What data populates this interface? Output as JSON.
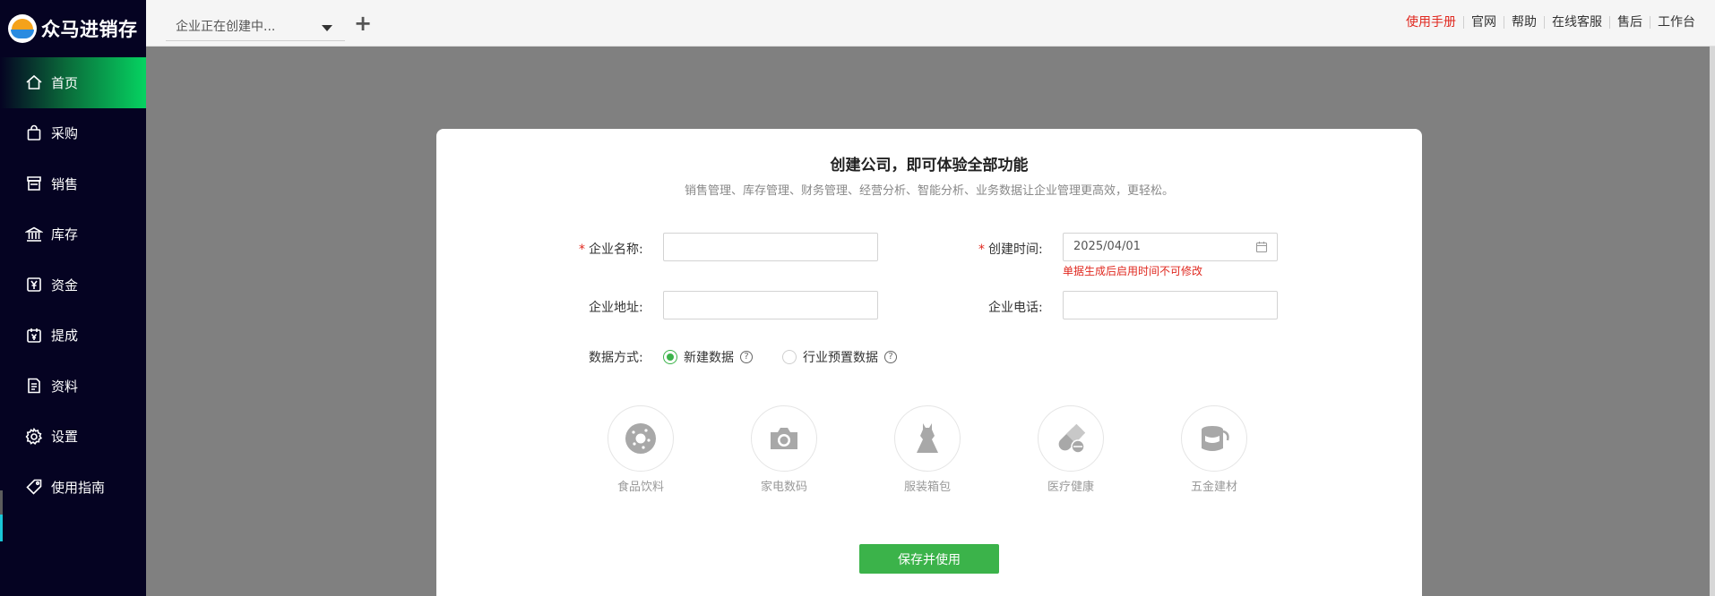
{
  "brand": {
    "name": "众马进销存",
    "logo_icon": "brand-logo"
  },
  "sidebar": {
    "items": [
      {
        "label": "首页",
        "icon": "home-icon",
        "active": true
      },
      {
        "label": "采购",
        "icon": "shopping-bag-icon"
      },
      {
        "label": "销售",
        "icon": "store-icon"
      },
      {
        "label": "库存",
        "icon": "bank-icon"
      },
      {
        "label": "资金",
        "icon": "yen-icon"
      },
      {
        "label": "提成",
        "icon": "calendar-yen-icon"
      },
      {
        "label": "资料",
        "icon": "document-icon"
      },
      {
        "label": "设置",
        "icon": "gear-icon"
      },
      {
        "label": "使用指南",
        "icon": "tag-icon"
      }
    ]
  },
  "topbar": {
    "company_select": "企业正在创建中...",
    "add_label": "+",
    "links": [
      "使用手册",
      "官网",
      "帮助",
      "在线客服",
      "售后",
      "工作台"
    ]
  },
  "form": {
    "title": "创建公司，即可体验全部功能",
    "subtitle": "销售管理、库存管理、财务管理、经营分析、智能分析、业务数据让企业管理更高效，更轻松。",
    "company_name_label": "企业名称:",
    "company_name_value": "",
    "create_time_label": "创建时间:",
    "create_time_value": "2025/04/01",
    "create_time_hint": "单据生成后启用时间不可修改",
    "address_label": "企业地址:",
    "address_value": "",
    "phone_label": "企业电话:",
    "phone_value": "",
    "data_mode_label": "数据方式:",
    "data_mode_options": [
      "新建数据",
      "行业预置数据"
    ],
    "data_mode_selected": "新建数据",
    "help_glyph": "?",
    "required_mark": "*",
    "industries": [
      {
        "name": "食品饮料",
        "icon": "donut-icon"
      },
      {
        "name": "家电数码",
        "icon": "camera-icon"
      },
      {
        "name": "服装箱包",
        "icon": "dress-icon"
      },
      {
        "name": "医疗健康",
        "icon": "pill-icon"
      },
      {
        "name": "五金建材",
        "icon": "paint-bucket-icon"
      }
    ],
    "save_button": "保存并使用"
  },
  "colors": {
    "sidebar_bg": "#050322",
    "active_green": "#06d361",
    "primary_green": "#3bb34a",
    "danger_red": "#e0281f",
    "overlay_gray": "#808080"
  }
}
